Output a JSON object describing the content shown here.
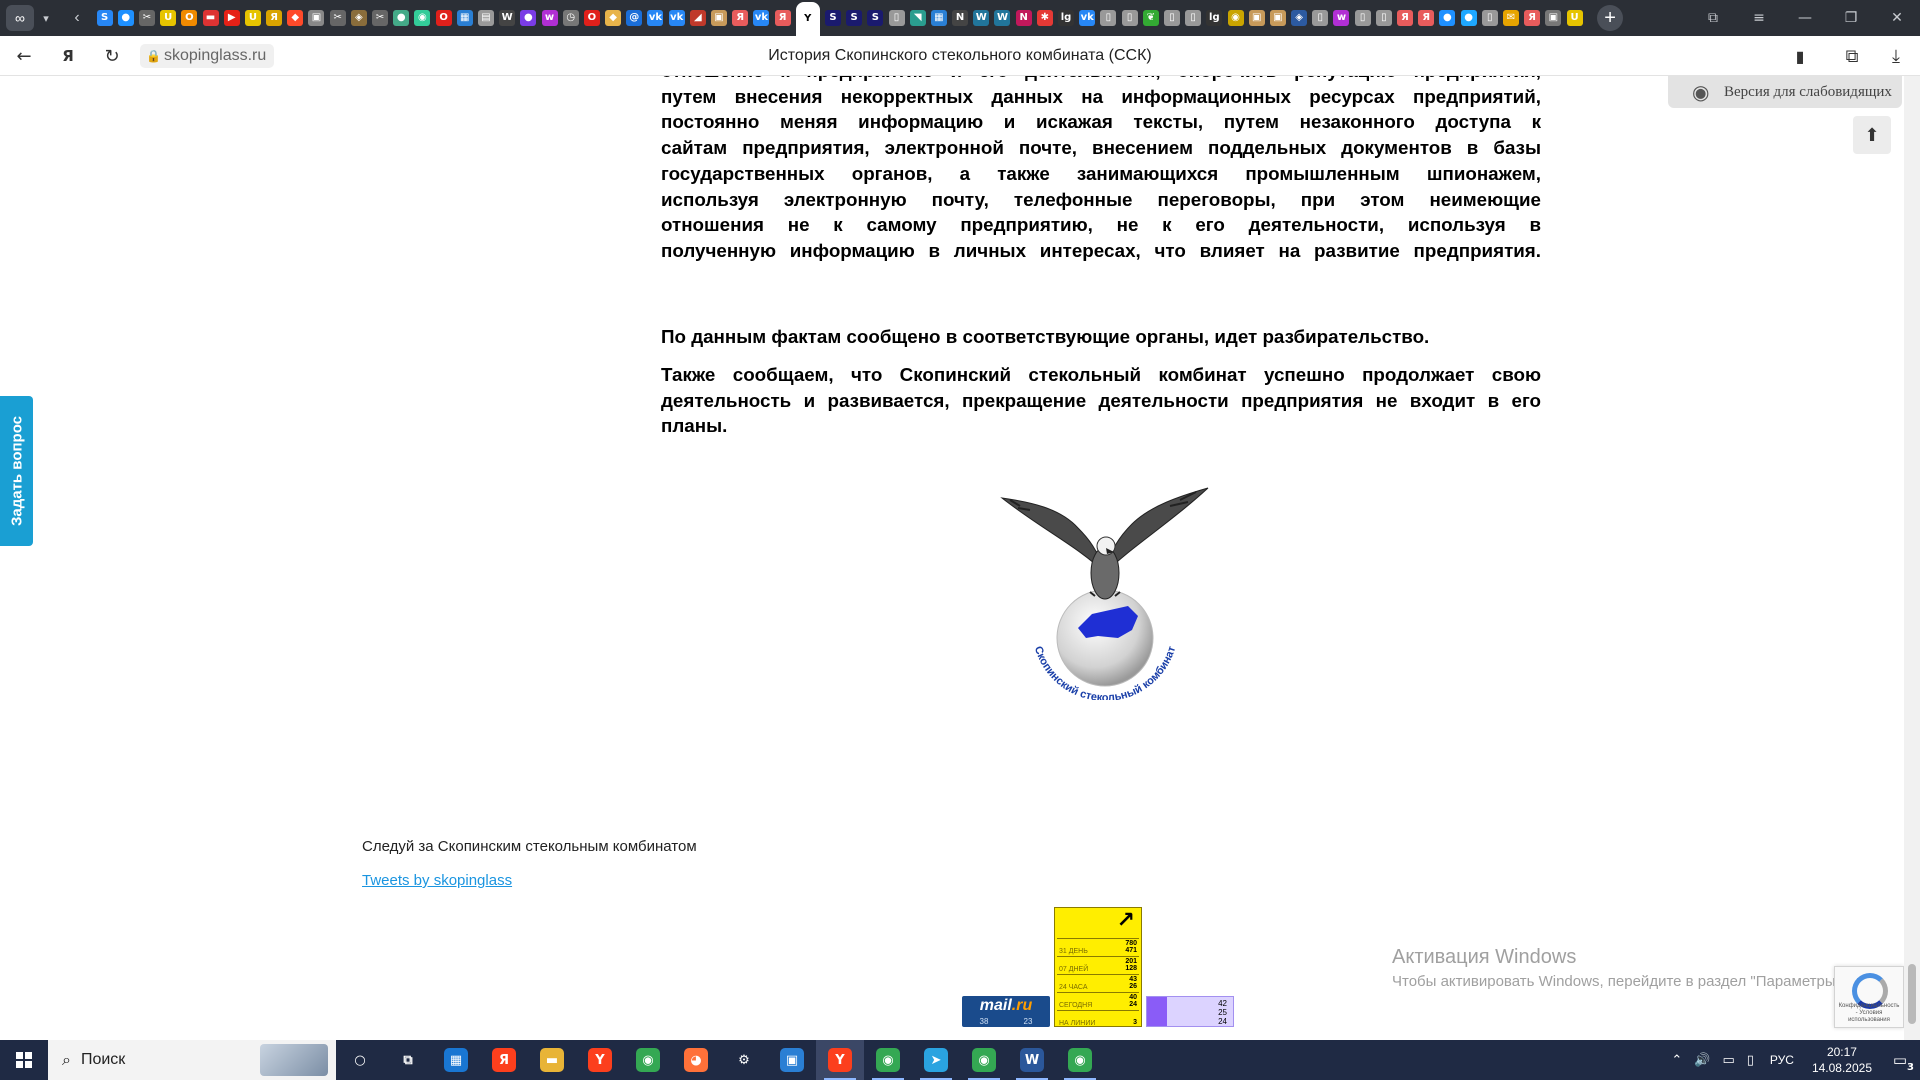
{
  "browser": {
    "tab_icons": [
      {
        "name": "tab-vk",
        "glyph": "S",
        "color": "#2787f5"
      },
      {
        "name": "tab-messenger",
        "glyph": "●",
        "color": "#1e90ff"
      },
      {
        "name": "tab-tools",
        "glyph": "✂",
        "color": "#666666"
      },
      {
        "name": "tab-u",
        "glyph": "U",
        "color": "#e6c400"
      },
      {
        "name": "tab-ok",
        "glyph": "О",
        "color": "#f08a00"
      },
      {
        "name": "tab-flag",
        "glyph": "▬",
        "color": "#d33"
      },
      {
        "name": "tab-youtube",
        "glyph": "▶",
        "color": "#e62117"
      },
      {
        "name": "tab-u2",
        "glyph": "U",
        "color": "#e6c400"
      },
      {
        "name": "tab-ya",
        "glyph": "Я",
        "color": "#d9a400"
      },
      {
        "name": "tab-compass",
        "glyph": "◆",
        "color": "#ff4a2a"
      },
      {
        "name": "tab-img",
        "glyph": "▣",
        "color": "#888888"
      },
      {
        "name": "tab-tools2",
        "glyph": "✂",
        "color": "#666666"
      },
      {
        "name": "tab-gov",
        "glyph": "◈",
        "color": "#8a6d3b"
      },
      {
        "name": "tab-tools3",
        "glyph": "✂",
        "color": "#666666"
      },
      {
        "name": "tab-globe",
        "glyph": "●",
        "color": "#4a8"
      },
      {
        "name": "tab-chrome",
        "glyph": "◉",
        "color": "#3c9"
      },
      {
        "name": "tab-opera",
        "glyph": "O",
        "color": "#e0201b"
      },
      {
        "name": "tab-grid",
        "glyph": "▦",
        "color": "#2a7fd4"
      },
      {
        "name": "tab-book",
        "glyph": "▤",
        "color": "#999999"
      },
      {
        "name": "tab-wiki",
        "glyph": "W",
        "color": "#444444"
      },
      {
        "name": "tab-purple",
        "glyph": "●",
        "color": "#7a3ce6"
      },
      {
        "name": "tab-wb",
        "glyph": "w",
        "color": "#b12fd4"
      },
      {
        "name": "tab-clock",
        "glyph": "◷",
        "color": "#777777"
      },
      {
        "name": "tab-opera2",
        "glyph": "O",
        "color": "#e0201b"
      },
      {
        "name": "tab-drop",
        "glyph": "◆",
        "color": "#e8b44a"
      },
      {
        "name": "tab-mail",
        "glyph": "@",
        "color": "#1a6ed8"
      },
      {
        "name": "tab-vk2",
        "glyph": "vk",
        "color": "#2787f5"
      },
      {
        "name": "tab-vk3",
        "glyph": "vk",
        "color": "#2787f5"
      },
      {
        "name": "tab-red",
        "glyph": "◢",
        "color": "#c0392b"
      },
      {
        "name": "tab-img2",
        "glyph": "▣",
        "color": "#c79a5a"
      },
      {
        "name": "tab-ya2",
        "glyph": "Я",
        "color": "#e85c5c"
      },
      {
        "name": "tab-vk4",
        "glyph": "vk",
        "color": "#2787f5"
      },
      {
        "name": "tab-ya3",
        "glyph": "Я",
        "color": "#e85c5c"
      },
      {
        "name": "tab-active-ya",
        "glyph": "Y",
        "color": "#ffffff",
        "active": true
      },
      {
        "name": "tab-s1",
        "glyph": "S",
        "color": "#1a1a6e"
      },
      {
        "name": "tab-s2",
        "glyph": "S",
        "color": "#1a1a6e"
      },
      {
        "name": "tab-s3",
        "glyph": "S",
        "color": "#1a1a6e"
      },
      {
        "name": "tab-doc",
        "glyph": "▯",
        "color": "#999999"
      },
      {
        "name": "tab-map",
        "glyph": "◥",
        "color": "#2a9d8f"
      },
      {
        "name": "tab-grid2",
        "glyph": "▦",
        "color": "#2a7fd4"
      },
      {
        "name": "tab-n",
        "glyph": "N",
        "color": "#444444"
      },
      {
        "name": "tab-wp",
        "glyph": "W",
        "color": "#21759b"
      },
      {
        "name": "tab-wp2",
        "glyph": "W",
        "color": "#21759b"
      },
      {
        "name": "tab-n2",
        "glyph": "N",
        "color": "#c2185b"
      },
      {
        "name": "tab-star",
        "glyph": "✱",
        "color": "#e53935"
      },
      {
        "name": "tab-lg",
        "glyph": "lg",
        "color": "#333333"
      },
      {
        "name": "tab-vk5",
        "glyph": "vk",
        "color": "#2787f5"
      },
      {
        "name": "tab-doc2",
        "glyph": "▯",
        "color": "#999999"
      },
      {
        "name": "tab-doc3",
        "glyph": "▯",
        "color": "#999999"
      },
      {
        "name": "tab-leaf",
        "glyph": "❦",
        "color": "#3a3"
      },
      {
        "name": "tab-doc4",
        "glyph": "▯",
        "color": "#999999"
      },
      {
        "name": "tab-doc5",
        "glyph": "▯",
        "color": "#999999"
      },
      {
        "name": "tab-lg2",
        "glyph": "lg",
        "color": "#333333"
      },
      {
        "name": "tab-coin",
        "glyph": "◉",
        "color": "#c9a400"
      },
      {
        "name": "tab-img3",
        "glyph": "▣",
        "color": "#c79a5a"
      },
      {
        "name": "tab-img4",
        "glyph": "▣",
        "color": "#c79a5a"
      },
      {
        "name": "tab-shield",
        "glyph": "◈",
        "color": "#2c5aa0"
      },
      {
        "name": "tab-doc6",
        "glyph": "▯",
        "color": "#999999"
      },
      {
        "name": "tab-wb2",
        "glyph": "w",
        "color": "#b12fd4"
      },
      {
        "name": "tab-doc7",
        "glyph": "▯",
        "color": "#999999"
      },
      {
        "name": "tab-doc8",
        "glyph": "▯",
        "color": "#999999"
      },
      {
        "name": "tab-ya4",
        "glyph": "Я",
        "color": "#e85c5c"
      },
      {
        "name": "tab-ya5",
        "glyph": "Я",
        "color": "#e85c5c"
      },
      {
        "name": "tab-chat",
        "glyph": "●",
        "color": "#1e90ff"
      },
      {
        "name": "tab-chat2",
        "glyph": "●",
        "color": "#1ea8ff"
      },
      {
        "name": "tab-doc9",
        "glyph": "▯",
        "color": "#999999"
      },
      {
        "name": "tab-mail2",
        "glyph": "✉",
        "color": "#e6a400"
      },
      {
        "name": "tab-ya6",
        "glyph": "Я",
        "color": "#e85c5c"
      },
      {
        "name": "tab-img5",
        "glyph": "▣",
        "color": "#777777"
      },
      {
        "name": "tab-u3",
        "glyph": "U",
        "color": "#e6c400"
      }
    ],
    "url_host": "skopinglass.ru",
    "page_title": "История Скопинского стекольного комбината (ССК)"
  },
  "article": {
    "para1_lines": [
      "отношение к предприятию и его деятельности, опорочить репутацию предприятия,",
      "путем внесения некорректных данных на информационных ресурсах предприятий,",
      "постоянно меняя информацию и искажая тексты, путем незаконного доступа к",
      "сайтам предприятия, электронной почте, внесением поддельных документов в базы",
      "государственных органов, а также занимающихся промышленным шпионажем,",
      "используя электронную почту, телефонные переговоры, при этом неимеющие",
      "отношения не к самому предприятию, не к его деятельности, используя в",
      "полученную информацию в личных интересах, что влияет на развитие предприятия."
    ],
    "para2": "По данным фактам сообщено в соответствующие органы, идет разбирательство.",
    "para3": " Также сообщаем, что Скопинский стекольный комбинат успешно продолжает свою деятельность и развивается, прекращение деятельности предприятия не входит в его планы."
  },
  "logo": {
    "ring_text": "Скопинский стекольный комбинат",
    "colors": {
      "eagle": "#3a3a3a",
      "globe": "#dcdcdc",
      "russia": "#1f2fd4",
      "ring_text": "#1a3fa8"
    }
  },
  "footer": {
    "follow_label": "Следуй за Скопинским стекольным комбинатом",
    "tweets_link": "Tweets by skopinglass"
  },
  "widgets": {
    "ask_question": "Задать вопрос",
    "accessibility": "Версия для слабовидящих",
    "win_activation_title": "Активация Windows",
    "win_activation_text": "Чтобы активировать Windows, перейдите в раздел \"Параметры\".",
    "recaptcha_terms": "Конфиденциальность - Условия использования"
  },
  "counters": {
    "mailru": {
      "brand_main": "mail",
      "brand_suffix": ".ru",
      "n1": "38",
      "n2": "23"
    },
    "liveinternet": {
      "rows": [
        {
          "label": "31 ДЕНЬ",
          "v1": "780",
          "v2": "471"
        },
        {
          "label": "07 ДНЕЙ",
          "v1": "201",
          "v2": "128"
        },
        {
          "label": "24 ЧАСА",
          "v1": "43",
          "v2": "26"
        },
        {
          "label": "СЕГОДНЯ",
          "v1": "40",
          "v2": "24"
        },
        {
          "label": "НА ЛИНИИ",
          "v1": "",
          "v2": "3"
        }
      ]
    },
    "yandex": {
      "c1": "42",
      "c2": "25",
      "c3": "24"
    }
  },
  "taskbar": {
    "search_placeholder": "Поиск",
    "apps": [
      {
        "name": "taskbar-cortana",
        "glyph": "○",
        "color": "transparent"
      },
      {
        "name": "taskbar-taskview",
        "glyph": "⧉",
        "color": "transparent"
      },
      {
        "name": "taskbar-store",
        "glyph": "▦",
        "color": "#1976d2"
      },
      {
        "name": "taskbar-yandex",
        "glyph": "Я",
        "color": "#fc3f1d"
      },
      {
        "name": "taskbar-explorer",
        "glyph": "▬",
        "color": "#e8b437"
      },
      {
        "name": "taskbar-yandex-browser",
        "glyph": "Y",
        "color": "#fc3f1d"
      },
      {
        "name": "taskbar-chrome",
        "glyph": "◉",
        "color": "#34a853"
      },
      {
        "name": "taskbar-firefox",
        "glyph": "◕",
        "color": "#ff7139"
      },
      {
        "name": "taskbar-settings",
        "glyph": "⚙",
        "color": "transparent"
      },
      {
        "name": "taskbar-app-blue",
        "glyph": "▣",
        "color": "#2a7fd4"
      },
      {
        "name": "taskbar-yandex-browser-active",
        "glyph": "Y",
        "color": "#fc3f1d",
        "active": true,
        "open": true
      },
      {
        "name": "taskbar-chrome-profile",
        "glyph": "◉",
        "color": "#34a853",
        "open": true
      },
      {
        "name": "taskbar-telegram",
        "glyph": "➤",
        "color": "#2aa3e0",
        "open": true
      },
      {
        "name": "taskbar-chrome-profile2",
        "glyph": "◉",
        "color": "#34a853",
        "open": true
      },
      {
        "name": "taskbar-word",
        "glyph": "W",
        "color": "#2b579a",
        "open": true
      },
      {
        "name": "taskbar-chrome-profile3",
        "glyph": "◉",
        "color": "#34a853",
        "open": true
      }
    ],
    "lang": "РУС",
    "time": "20:17",
    "date": "14.08.2025",
    "notifications": "3"
  }
}
